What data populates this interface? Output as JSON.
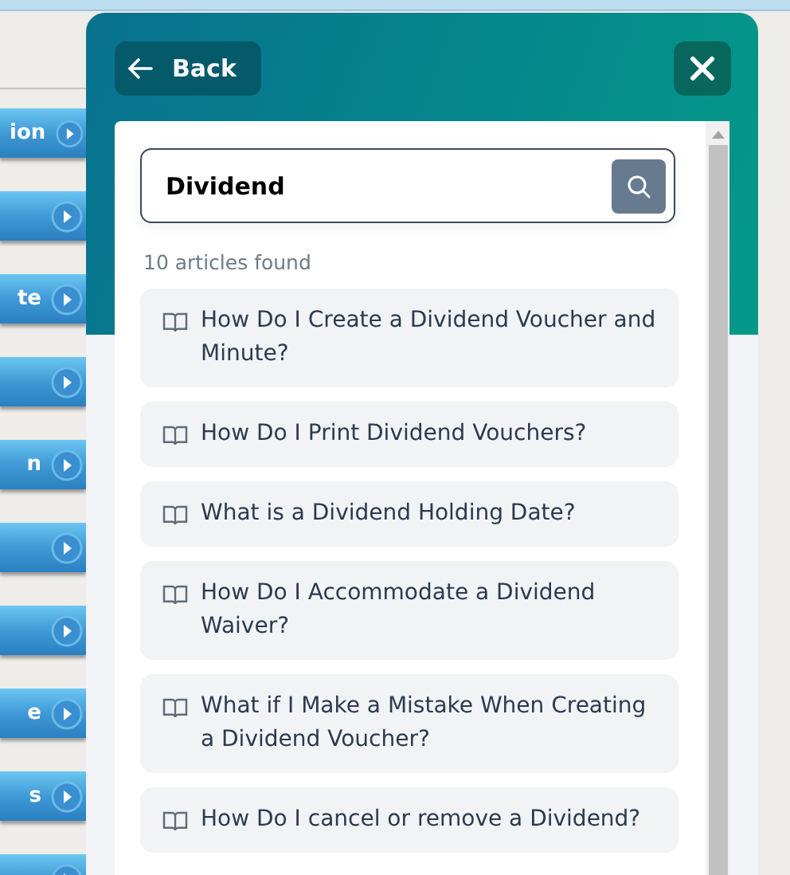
{
  "sidebar": {
    "items": [
      {
        "kind": "labeled",
        "label": "ion"
      },
      {
        "kind": "plain"
      },
      {
        "kind": "labeled",
        "label": "te"
      },
      {
        "kind": "plain"
      },
      {
        "kind": "labeled",
        "label": "n"
      },
      {
        "kind": "plain"
      },
      {
        "kind": "plain"
      },
      {
        "kind": "labeled",
        "label": "e"
      },
      {
        "kind": "labeled",
        "label": "s"
      },
      {
        "kind": "plain"
      }
    ]
  },
  "panel": {
    "back_button": "Back",
    "search": {
      "value": "Dividend"
    },
    "result_count": "10 articles found",
    "articles": [
      {
        "title": "How Do I Create a Dividend Voucher and Minute?"
      },
      {
        "title": "How Do I Print Dividend Vouchers?"
      },
      {
        "title": "What is a Dividend Holding Date?"
      },
      {
        "title": "How Do I Accommodate a Dividend Waiver?"
      },
      {
        "title": "What if I Make a Mistake When Creating a Dividend Voucher?"
      },
      {
        "title": "How Do I cancel or remove a Dividend?"
      }
    ]
  }
}
